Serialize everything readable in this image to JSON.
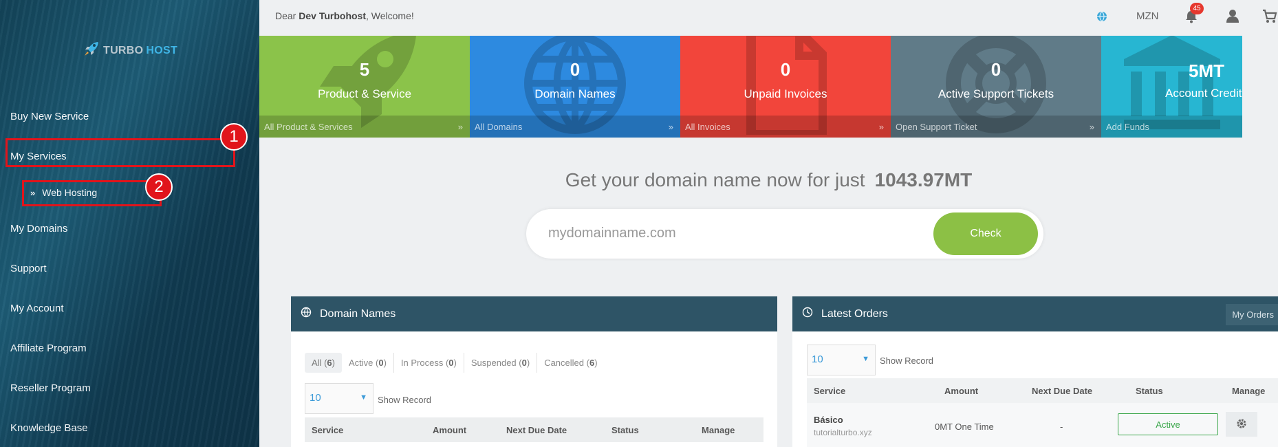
{
  "header": {
    "greeting_prefix": "Dear",
    "user_name": "Dev Turbohost",
    "greeting_suffix": ", Welcome!",
    "currency": "MZN",
    "notification_count": "45"
  },
  "logo": {
    "part1": "TURBO",
    "part2": "HOST"
  },
  "sidebar": {
    "items": [
      {
        "label": "Buy New Service"
      },
      {
        "label": "My Services"
      },
      {
        "label": "My Domains"
      },
      {
        "label": "Support"
      },
      {
        "label": "My Account"
      },
      {
        "label": "Affiliate Program"
      },
      {
        "label": "Reseller Program"
      },
      {
        "label": "Knowledge Base"
      }
    ],
    "sub_item": {
      "label": "Web Hosting"
    },
    "callouts": [
      "1",
      "2"
    ]
  },
  "tiles": [
    {
      "count": "5",
      "label": "Product & Service",
      "link": "All Product & Services",
      "arrow": "»",
      "color": "#8bc34a",
      "icon": "rocket-icon"
    },
    {
      "count": "0",
      "label": "Domain Names",
      "link": "All Domains",
      "arrow": "»",
      "color": "#2d8ae0",
      "icon": "globe-icon"
    },
    {
      "count": "0",
      "label": "Unpaid Invoices",
      "link": "All Invoices",
      "arrow": "»",
      "color": "#f2453b",
      "icon": "document-icon"
    },
    {
      "count": "0",
      "label": "Active Support Tickets",
      "link": "Open Support Ticket",
      "arrow": "»",
      "color": "#607b88",
      "icon": "lifebuoy-icon"
    },
    {
      "count": "5MT",
      "label": "Account Credits",
      "link": "Add Funds",
      "arrow": "",
      "color": "#27b6d2",
      "icon": "bank-icon"
    }
  ],
  "domain_search": {
    "title": "Get your domain name now for just",
    "price": "1043.97MT",
    "placeholder": "mydomainname.com",
    "button": "Check"
  },
  "domain_panel": {
    "title": "Domain Names",
    "filters": [
      {
        "label": "All",
        "count": "6"
      },
      {
        "label": "Active",
        "count": "0"
      },
      {
        "label": "In Process",
        "count": "0"
      },
      {
        "label": "Suspended",
        "count": "0"
      },
      {
        "label": "Cancelled",
        "count": "6"
      }
    ],
    "page_size": "10",
    "show_record": "Show Record",
    "columns": [
      "Service",
      "Amount",
      "Next Due Date",
      "Status",
      "Manage"
    ]
  },
  "orders_panel": {
    "title": "Latest Orders",
    "my_orders": "My Orders",
    "page_size": "10",
    "show_record": "Show Record",
    "columns": [
      "Service",
      "Amount",
      "Next Due Date",
      "Status",
      "Manage"
    ],
    "rows": [
      {
        "service": "Básico",
        "domain": "tutorialturbo.xyz",
        "amount": "0MT One Time",
        "due": "-",
        "status": "Active"
      }
    ]
  }
}
